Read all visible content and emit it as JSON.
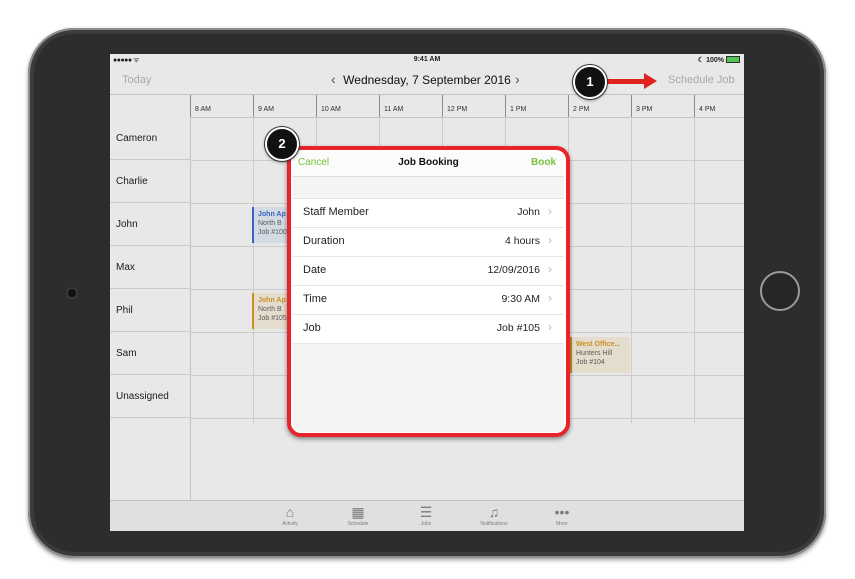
{
  "status_bar": {
    "signal": "●●●●● ᯤ",
    "time": "9:41 AM",
    "battery": "☾ 100%"
  },
  "nav": {
    "today": "Today",
    "date": "Wednesday, 7 September 2016",
    "prev": "‹",
    "next": "›",
    "schedule_job": "Schedule Job"
  },
  "time_slots": [
    "8 AM",
    "9 AM",
    "10 AM",
    "11 AM",
    "12 PM",
    "1 PM",
    "2 PM",
    "3 PM",
    "4 PM"
  ],
  "staff": [
    "Cameron",
    "Charlie",
    "John",
    "Max",
    "Phil",
    "Sam",
    "Unassigned"
  ],
  "events": [
    {
      "title": "John Ap",
      "line2": "North B",
      "line3": "Job #100"
    },
    {
      "title": "John Ap",
      "line2": "North B",
      "line3": "Job #105"
    },
    {
      "title": "West Office...",
      "line2": "Hunters Hill",
      "line3": "Job #104"
    }
  ],
  "modal": {
    "cancel": "Cancel",
    "title": "Job Booking",
    "book": "Book",
    "rows": [
      {
        "label": "Staff Member",
        "value": "John"
      },
      {
        "label": "Duration",
        "value": "4 hours"
      },
      {
        "label": "Date",
        "value": "12/09/2016"
      },
      {
        "label": "Time",
        "value": "9:30 AM"
      },
      {
        "label": "Job",
        "value": "Job #105"
      }
    ]
  },
  "tabs": [
    {
      "label": "Activity",
      "icon": "house-icon",
      "glyph": "⌂"
    },
    {
      "label": "Schedule",
      "icon": "calendar-icon",
      "glyph": "▦"
    },
    {
      "label": "Jobs",
      "icon": "list-icon",
      "glyph": "☰"
    },
    {
      "label": "Notifications",
      "icon": "bell-icon",
      "glyph": "♫"
    },
    {
      "label": "More",
      "icon": "more-icon",
      "glyph": "•••"
    }
  ],
  "callouts": [
    "1",
    "2"
  ],
  "chevron": "›",
  "colors": {
    "accent_green": "#78c23a",
    "annotation_red": "#e8232a",
    "event_blue": "#3d6fd8",
    "event_orange": "#e0a02a"
  }
}
